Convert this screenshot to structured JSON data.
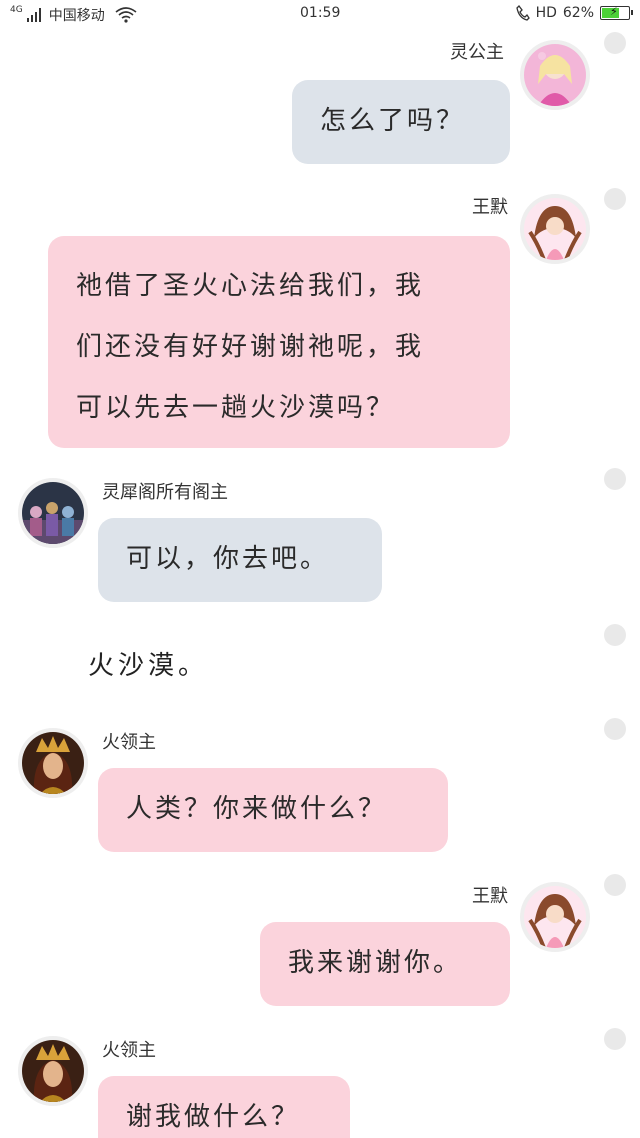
{
  "status_bar": {
    "network": "4G",
    "carrier": "中国移动",
    "time": "01:59",
    "hd": "HD",
    "battery_percent": "62%",
    "battery_level": 0.62
  },
  "messages": [
    {
      "side": "right",
      "name": "灵公主",
      "text": "怎么了吗？",
      "bubble_color": "#dde3ea",
      "avatar": "princess-pink-avatar"
    },
    {
      "side": "right",
      "name": "王默",
      "lines": [
        "祂借了圣火心法给我们，我",
        "们还没有好好谢谢祂呢，我",
        "可以先去一趟火沙漠吗？"
      ],
      "bubble_color": "#fbd3dc",
      "avatar": "wangmo-avatar"
    },
    {
      "side": "left",
      "name": "灵犀阁所有阁主",
      "text": "可以，你去吧。",
      "bubble_color": "#dde3ea",
      "avatar": "group-avatar"
    },
    {
      "scene_text": "火沙漠。"
    },
    {
      "side": "left",
      "name": "火领主",
      "text": "人类？你来做什么？",
      "bubble_color": "#fbd3dc",
      "avatar": "fire-lord-avatar"
    },
    {
      "side": "right",
      "name": "王默",
      "text": "我来谢谢你。",
      "bubble_color": "#fbd3dc",
      "avatar": "wangmo-avatar"
    },
    {
      "side": "left",
      "name": "火领主",
      "text": "谢我做什么？",
      "bubble_color": "#fbd3dc",
      "avatar": "fire-lord-avatar"
    }
  ]
}
